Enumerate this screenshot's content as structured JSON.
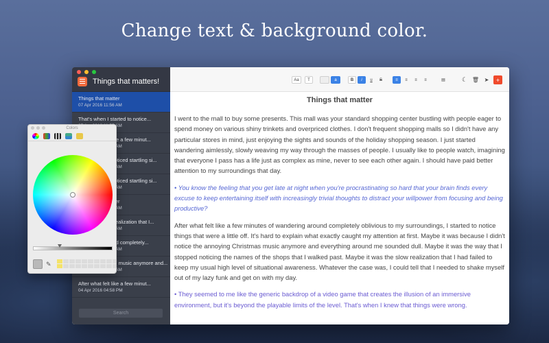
{
  "headline": "Change text & background color.",
  "window": {
    "sidebar_title": "Things that matters!",
    "search_placeholder": "Search",
    "notes": [
      {
        "title": "Things that matter",
        "date": "07 Apr 2016 11:56 AM",
        "active": true
      },
      {
        "title": "That's when I started to notice...",
        "date": "07 Apr 2016 11:55 AM"
      },
      {
        "title": "After what felt like a few minut...",
        "date": "07 Apr 2016 11:54 AM"
      },
      {
        "title": "It was the first noticed startling si...",
        "date": "07 Apr 2016 11:52 AM"
      },
      {
        "title": "It was the first noticed startling si...",
        "date": "07 Apr 2016 11:54 AM"
      },
      {
        "title": "Things that matter",
        "date": "07 Apr 2016 11:56 AM"
      },
      {
        "title": "It was the slow realization that I...",
        "date": "07 Apr 2016 11:56 AM"
      },
      {
        "title": "After what I found completely...",
        "date": "06 Apr 2016 11:56 AM"
      },
      {
        "title": "I didn't notice the music anymore and...",
        "date": "05 Apr 2016 11:56 AM"
      },
      {
        "title": "After what felt like a few minut...",
        "date": "04 Apr 2016 04:58 PM"
      }
    ],
    "toolbar": {
      "font_btn": "Aa",
      "text_btn": "T",
      "highlight_btn": "a",
      "bold": "B",
      "italic": "i",
      "underline": "u",
      "strike": "S",
      "add": "+"
    },
    "doc": {
      "title": "Things that matter",
      "p1": "I went to the mall to buy some presents. This mall was your standard shopping center bustling with people eager to spend money on various shiny trinkets and overpriced clothes. I don't frequent shopping malls so I didn't have any particular stores in mind, just enjoying the sights and sounds of the holiday shopping season. I just started wandering aimlessly, slowly weaving my way through the masses of people. I usually like to people watch, imagining that everyone I pass has a life just as complex as mine, never to see each other again. I should have paid better attention to my surroundings that day.",
      "p2": "• You know the feeling that you get late at night when you're procrastinating so hard that your brain finds every excuse to keep entertaining itself with increasingly trivial thoughts to distract your willpower from focusing and being productive?",
      "p3": "After what felt like a few minutes of wandering around completely oblivious to my surroundings, I started to notice things that were a little off. It's hard to explain what exactly caught my attention at first. Maybe it was because I didn't notice the annoying Christmas music anymore and everything around me sounded dull. Maybe it was the way that I stopped noticing the names of the shops that I walked past. Maybe it was the slow realization that I had failed to keep my usual high level of situational awareness. Whatever the case was, I could tell that I needed to shake myself out of my lazy funk and get on with my day.",
      "p4": "• They seemed to me like the generic backdrop of a video game that creates the illusion of an immersive environment, but it's beyond the playable limits of the level. That's when I knew that things were wrong."
    }
  },
  "colors_panel": {
    "title": "Colors"
  },
  "palette": {
    "accent_blue": "#1e4fa8",
    "accent_orange": "#f26a3d",
    "quote_color": "#5667d4"
  }
}
